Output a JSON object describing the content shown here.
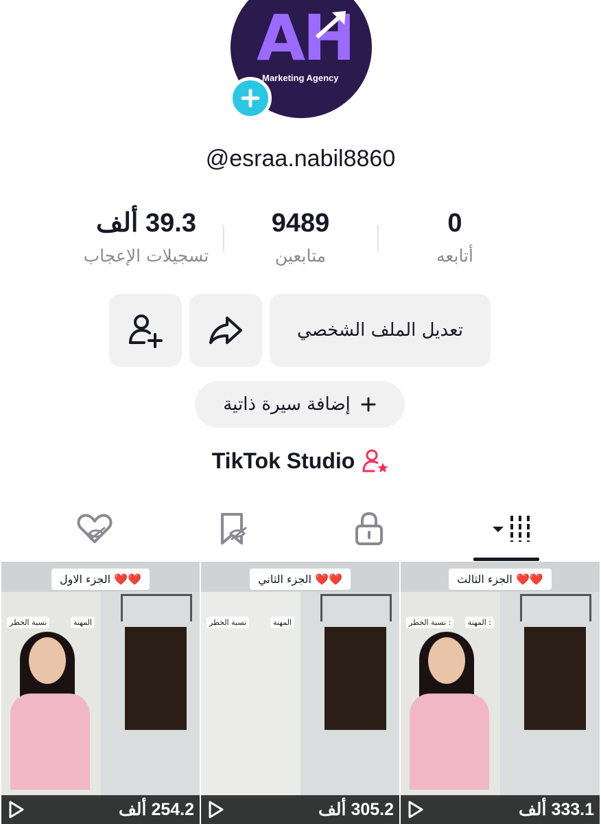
{
  "profile": {
    "username": "@esraa.nabil8860",
    "avatar_letters": "AH",
    "avatar_subtitle": "Marketing Agency",
    "brand_colors": {
      "avatar_bg": "#2a1a4e",
      "logo": "#9b6bff",
      "add_badge": "#2bc6e3",
      "accent": "#fe2c55"
    }
  },
  "stats": [
    {
      "value": "39.3 ألف",
      "label": "تسجيلات الإعجاب"
    },
    {
      "value": "9489",
      "label": "متابعين"
    },
    {
      "value": "0",
      "label": "أتابعه"
    }
  ],
  "actions": {
    "edit_profile": "تعديل الملف الشخصي",
    "share_icon": "share-arrow-icon",
    "add_friend_icon": "add-user-icon",
    "add_bio": "إضافة سيرة ذاتية"
  },
  "studio": {
    "label": "TikTok Studio",
    "icon": "user-star-icon"
  },
  "tabs": [
    {
      "icon": "grid-bars-icon",
      "active": true
    },
    {
      "icon": "lock-icon",
      "active": false
    },
    {
      "icon": "bookmark-hidden-icon",
      "active": false
    },
    {
      "icon": "heart-hidden-icon",
      "active": false
    }
  ],
  "videos": [
    {
      "caption": "الجزء الاول ❤️❤️",
      "label_job": "المهنة",
      "label_risk": "نسبة الخطر",
      "views": "254.2 ألف"
    },
    {
      "caption": "الجزء الثاني ❤️❤️",
      "label_job": "المهنة",
      "label_risk": "نسبة الخطر",
      "views": "305.2 ألف"
    },
    {
      "caption": "الجزء الثالث ❤️❤️",
      "label_job": "المهنة :",
      "label_risk": "نسبة الخطر :",
      "views": "333.1 ألف"
    }
  ]
}
